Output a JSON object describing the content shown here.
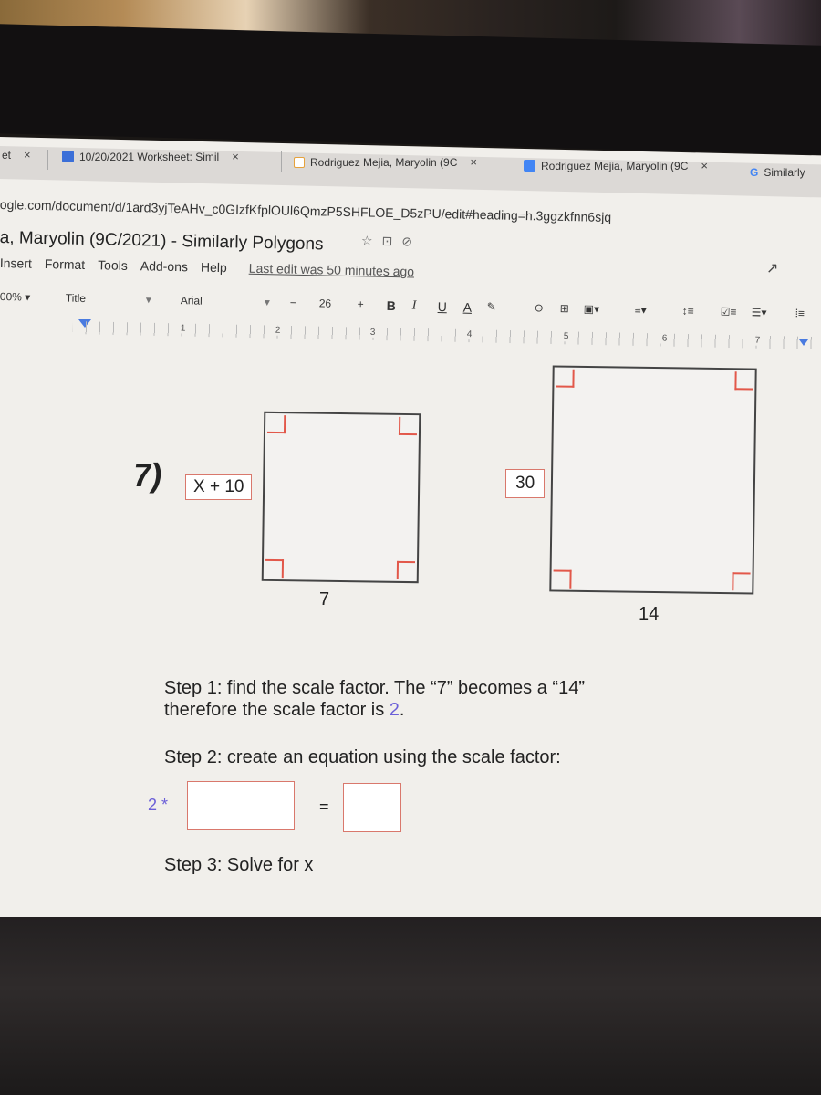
{
  "browser": {
    "tabs": [
      {
        "label": "et",
        "close": "×"
      },
      {
        "label": "10/20/2021 Worksheet: Simil",
        "close": "×"
      },
      {
        "label": "Rodriguez Mejia, Maryolin (9C",
        "close": "×"
      },
      {
        "label": "Rodriguez Mejia, Maryolin (9C",
        "close": "×"
      },
      {
        "label": "Similarly"
      }
    ],
    "url": "ogle.com/document/d/1ard3yjTeAHv_c0GIzfKfplOUl6QmzP5SHFLOE_D5zPU/edit#heading=h.3ggzkfnn6sjq"
  },
  "doc": {
    "title": "a, Maryolin (9C/2021) - Similarly Polygons",
    "menu": [
      "Insert",
      "Format",
      "Tools",
      "Add-ons",
      "Help"
    ],
    "last_edit": "Last edit was 50 minutes ago"
  },
  "toolbar": {
    "zoom": "00%",
    "style": "Title",
    "font": "Arial",
    "minus": "−",
    "font_size": "26",
    "plus": "+",
    "bold": "B",
    "italic": "I",
    "underline": "U",
    "text_color": "A"
  },
  "ruler": {
    "marks": [
      "1",
      "2",
      "3",
      "4",
      "5",
      "6",
      "7"
    ]
  },
  "problem": {
    "number": "7)",
    "small_side_label": "X + 10",
    "small_bottom_label": "7",
    "large_side_label": "30",
    "large_bottom_label": "14",
    "step1_line1": "Step 1: find the scale factor. The “7” becomes a “14”",
    "step1_line2_prefix": "therefore the scale factor is ",
    "step1_scale": "2",
    "step1_line2_suffix": ".",
    "step2": "Step 2: create an equation using the scale factor:",
    "eq_prefix": "2 *",
    "eq_equals": "=",
    "step3": "Step 3: Solve for x"
  },
  "colors": {
    "accent": "#6b5fd8",
    "right_angle_marks": "#e2584a"
  }
}
